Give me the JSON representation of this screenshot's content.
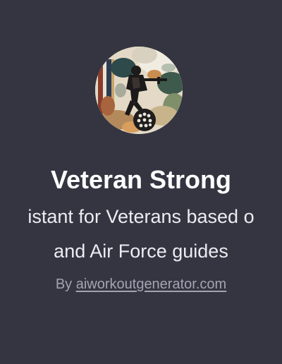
{
  "gpt": {
    "avatar_icon": "veteran-soldier-collage-icon",
    "name": "Veteran Strong",
    "description_lines": [
      "istant for Veterans based o",
      "and Air Force guides"
    ],
    "byline_prefix": "By",
    "author": "aiworkoutgenerator.com"
  },
  "colors": {
    "background": "#343541",
    "title": "#ffffff",
    "description": "#ececf1",
    "byline": "#a3a4b1"
  }
}
